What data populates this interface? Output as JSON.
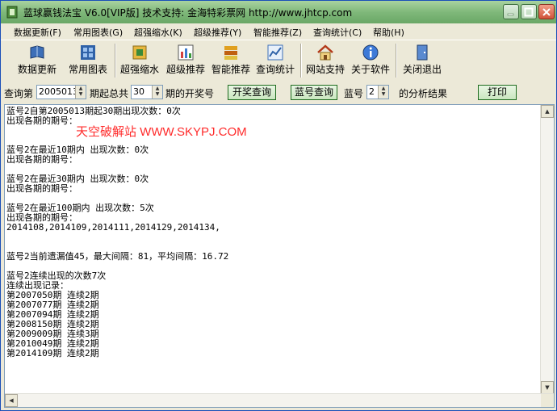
{
  "window": {
    "title": "蓝球赢钱法宝  V6.0[VIP版]  技术支持: 金海特彩票网  http://www.jhtcp.com"
  },
  "menu": [
    "数据更新(F)",
    "常用图表(G)",
    "超强缩水(K)",
    "超级推荐(Y)",
    "智能推荐(Z)",
    "查询统计(C)",
    "帮助(H)"
  ],
  "toolbar": [
    {
      "label": "数据更新",
      "icon": "book-icon"
    },
    {
      "label": "常用图表",
      "icon": "chart-grid-icon"
    },
    {
      "label": "超强缩水",
      "icon": "shrink-icon"
    },
    {
      "label": "超级推荐",
      "icon": "bar-chart-icon"
    },
    {
      "label": "智能推荐",
      "icon": "layers-icon"
    },
    {
      "label": "查询统计",
      "icon": "statistics-icon"
    },
    {
      "label": "网站支持",
      "icon": "house-icon"
    },
    {
      "label": "关于软件",
      "icon": "info-icon"
    },
    {
      "label": "关闭退出",
      "icon": "exit-door-icon"
    }
  ],
  "query": {
    "prefix": "查询第",
    "issue_value": "2005013",
    "middle": "期起总共",
    "count_value": "30",
    "suffix": "期的开奖号",
    "draw_button": "开奖查询",
    "blue_button": "蓝号查询",
    "blue_label": "蓝号",
    "blue_value": "2",
    "result_label": "的分析结果",
    "print_button": "打印"
  },
  "output": {
    "watermark": "天空破解站 WWW.SKYPJ.COM",
    "lines": [
      "蓝号2自第2005013期起30期出现次数：0次",
      "出现各期的期号：",
      "",
      "",
      "蓝号2在最近10期内 出现次数：0次",
      "出现各期的期号：",
      "",
      "蓝号2在最近30期内 出现次数：0次",
      "出现各期的期号：",
      "",
      "蓝号2在最近100期内 出现次数：5次",
      "出现各期的期号：",
      "2014108,2014109,2014111,2014129,2014134,",
      "",
      "",
      "蓝号2当前遗漏值45，最大间隔：81，平均间隔：16.72",
      "",
      "蓝号2连续出现的次数7次",
      "连续出现记录：",
      "第2007050期 连续2期",
      "第2007077期 连续2期",
      "第2007094期 连续2期",
      "第2008150期 连续2期",
      "第2009009期 连续3期",
      "第2010049期 连续2期",
      "第2014109期 连续2期"
    ]
  }
}
